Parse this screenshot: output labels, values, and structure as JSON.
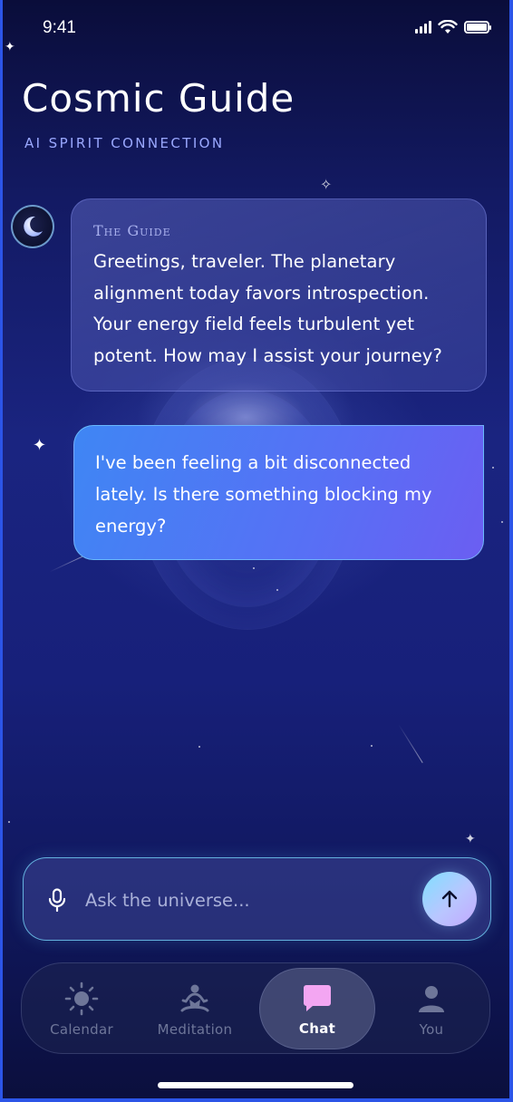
{
  "status_bar": {
    "time": "9:41"
  },
  "header": {
    "title": "Cosmic Guide",
    "subtitle": "AI SPIRIT CONNECTION"
  },
  "messages": [
    {
      "role": "guide",
      "sender": "The Guide",
      "text": "Greetings, traveler. The planetary alignment today favors introspection. Your energy field feels turbulent yet potent. How may I assist your journey?"
    },
    {
      "role": "user",
      "text": "I've been feeling a bit disconnected lately. Is there something blocking my energy?"
    }
  ],
  "input": {
    "placeholder": "Ask the universe...",
    "value": ""
  },
  "tabs": [
    {
      "label": "Calendar",
      "icon": "sun-icon",
      "active": false
    },
    {
      "label": "Meditation",
      "icon": "meditation-icon",
      "active": false
    },
    {
      "label": "Chat",
      "icon": "chat-icon",
      "active": true
    },
    {
      "label": "You",
      "icon": "person-icon",
      "active": false
    }
  ],
  "colors": {
    "accent": "#9aa8ff",
    "user_bubble_start": "#3f86f4",
    "user_bubble_end": "#6b5ef2",
    "chat_icon": "#f3a6f2"
  }
}
